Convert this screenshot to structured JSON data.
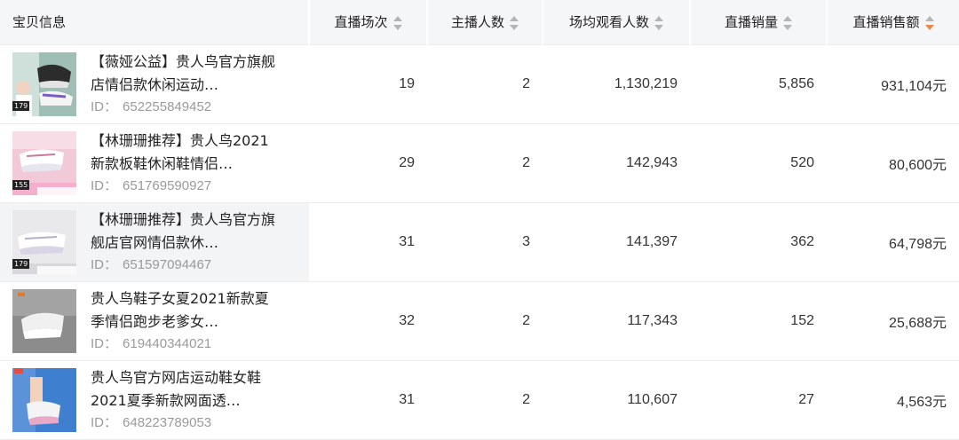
{
  "header": {
    "info_label": "宝贝信息",
    "columns": [
      {
        "label": "直播场次",
        "sort": "none"
      },
      {
        "label": "主播人数",
        "sort": "none"
      },
      {
        "label": "场均观看人数",
        "sort": "none"
      },
      {
        "label": "直播销量",
        "sort": "none"
      },
      {
        "label": "直播销售额",
        "sort": "desc"
      }
    ]
  },
  "id_prefix": "ID：",
  "rows": [
    {
      "title": "【薇娅公益】贵人鸟官方旗舰店情侣款休闲运动…",
      "id": "652255849452",
      "thumb": "shoe-photo-model",
      "price_tag": "179",
      "sessions": "19",
      "anchors": "2",
      "avg_viewers": "1,130,219",
      "sales_volume": "5,856",
      "sales_amount": "931,104元"
    },
    {
      "title": "【林珊珊推荐】贵人鸟2021新款板鞋休闲鞋情侣…",
      "id": "651769590927",
      "thumb": "shoe-photo-pink",
      "price_tag": "155",
      "sessions": "29",
      "anchors": "2",
      "avg_viewers": "142,943",
      "sales_volume": "520",
      "sales_amount": "80,600元"
    },
    {
      "title": "【林珊珊推荐】贵人鸟官方旗舰店官网情侣款休…",
      "id": "651597094467",
      "thumb": "shoe-photo-white",
      "price_tag": "179",
      "sessions": "31",
      "anchors": "3",
      "avg_viewers": "141,397",
      "sales_volume": "362",
      "sales_amount": "64,798元"
    },
    {
      "title": "贵人鸟鞋子女夏2021新款夏季情侣跑步老爹女…",
      "id": "619440344021",
      "thumb": "shoe-photo-gray",
      "price_tag": "",
      "sessions": "32",
      "anchors": "2",
      "avg_viewers": "117,343",
      "sales_volume": "152",
      "sales_amount": "25,688元"
    },
    {
      "title": "贵人鸟官方网店运动鞋女鞋2021夏季新款网面透…",
      "id": "648223789053",
      "thumb": "shoe-photo-blue",
      "price_tag": "",
      "sessions": "31",
      "anchors": "2",
      "avg_viewers": "110,607",
      "sales_volume": "27",
      "sales_amount": "4,563元"
    }
  ]
}
